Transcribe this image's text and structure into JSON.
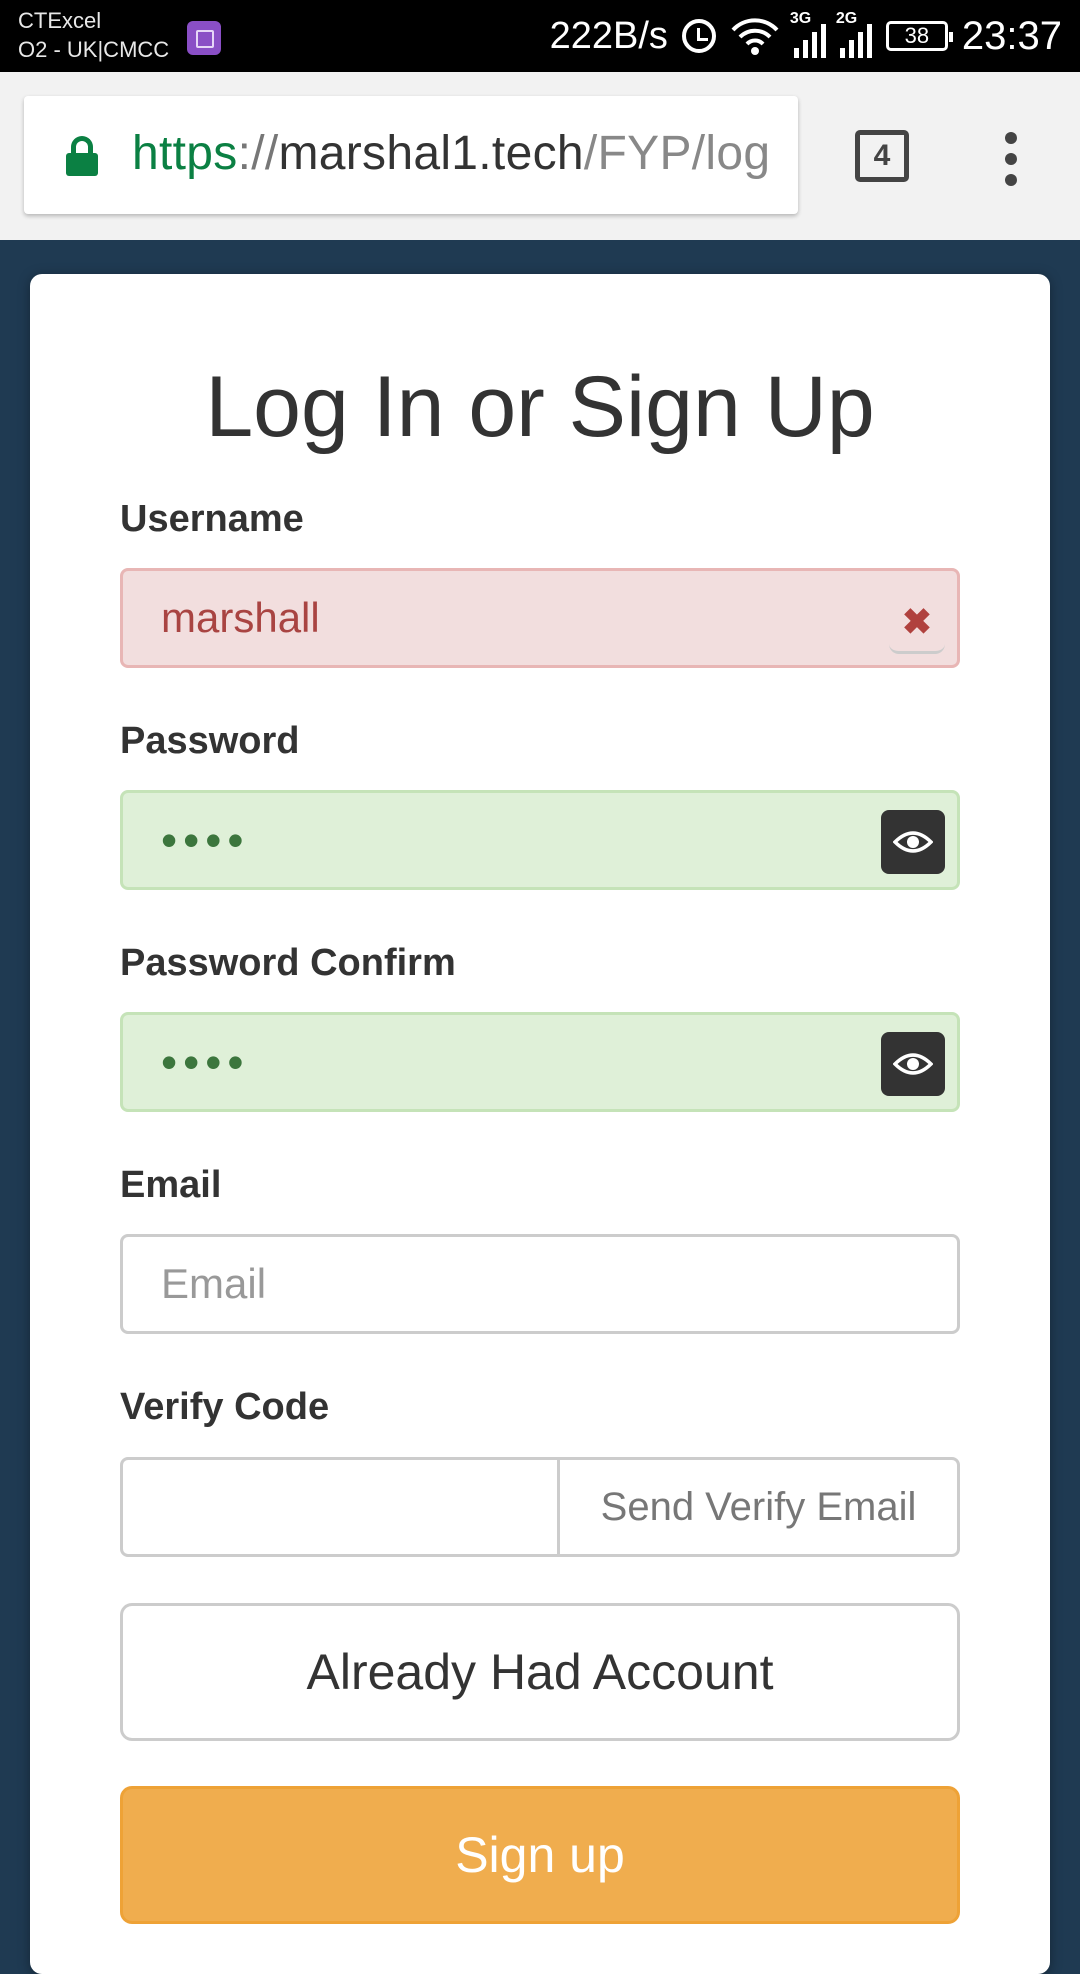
{
  "status_bar": {
    "carrier_1": "CTExcel",
    "carrier_2": "O2 - UK|CMCC",
    "net_speed": "222B/s",
    "network_1": "3G",
    "network_2": "2G",
    "battery": "38",
    "time": "23:37"
  },
  "browser": {
    "url_scheme": "https",
    "url_separator": "://",
    "url_host": "marshal1.tech",
    "url_path": "/FYP/log",
    "tab_count": "4"
  },
  "form": {
    "title": "Log In or Sign Up",
    "username_label": "Username",
    "username_value": "marshall",
    "username_clear_glyph": "✖",
    "password_label": "Password",
    "password_value": "••••",
    "password_confirm_label": "Password Confirm",
    "password_confirm_value": "••••",
    "email_label": "Email",
    "email_placeholder": "Email",
    "verify_label": "Verify Code",
    "verify_value": "",
    "send_verify_label": "Send Verify Email",
    "already_account_label": "Already Had Account",
    "signup_label": "Sign up"
  },
  "colors": {
    "page_bg": "#1f3a52",
    "error_bg": "#f2dede",
    "success_bg": "#dff0d8",
    "signup_button": "#f0ad4e",
    "secure_green": "#0b8043"
  },
  "icons": {
    "lock": "lock-icon",
    "tabs": "tab-switcher-icon",
    "menu": "overflow-menu-icon",
    "clear": "close-icon",
    "show_password": "eye-icon"
  }
}
